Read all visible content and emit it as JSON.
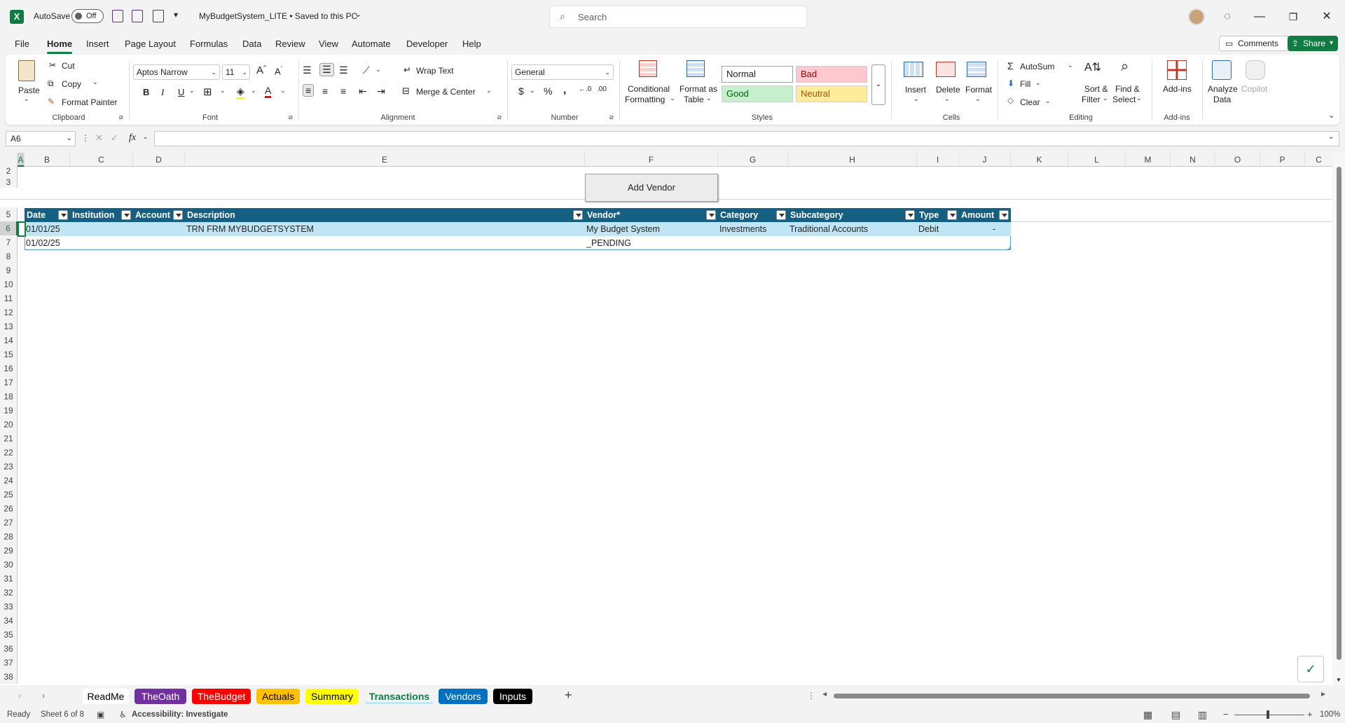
{
  "titlebar": {
    "autosave_label": "AutoSave",
    "autosave_state": "Off",
    "doc_title": "MyBudgetSystem_LITE • Saved to this PC",
    "search_placeholder": "Search"
  },
  "menu": [
    "File",
    "Home",
    "Insert",
    "Page Layout",
    "Formulas",
    "Data",
    "Review",
    "View",
    "Automate",
    "Developer",
    "Help"
  ],
  "menu_active": "Home",
  "comments_label": "Comments",
  "share_label": "Share",
  "ribbon": {
    "clipboard": {
      "paste": "Paste",
      "cut": "Cut",
      "copy": "Copy",
      "format_painter": "Format Painter",
      "label": "Clipboard"
    },
    "font": {
      "name": "Aptos Narrow",
      "size": "11",
      "label": "Font",
      "bold": "B",
      "italic": "I",
      "underline": "U"
    },
    "alignment": {
      "wrap": "Wrap Text",
      "merge": "Merge & Center",
      "label": "Alignment"
    },
    "number": {
      "format": "General",
      "label": "Number"
    },
    "styles": {
      "conditional": "Conditional",
      "conditional2": "Formatting",
      "format_table": "Format as",
      "format_table2": "Table",
      "normal": "Normal",
      "bad": "Bad",
      "good": "Good",
      "neutral": "Neutral",
      "label": "Styles"
    },
    "cells": {
      "insert": "Insert",
      "delete": "Delete",
      "format": "Format",
      "label": "Cells"
    },
    "editing": {
      "autosum": "AutoSum",
      "fill": "Fill",
      "clear": "Clear",
      "sort": "Sort &",
      "sort2": "Filter",
      "find": "Find &",
      "find2": "Select",
      "label": "Editing"
    },
    "addins": {
      "addins": "Add-ins",
      "label": "Add-ins"
    },
    "analyze": {
      "line1": "Analyze",
      "line2": "Data"
    },
    "copilot": "Copilot"
  },
  "formula": {
    "namebox": "A6",
    "fx": "fx",
    "content": ""
  },
  "columns": [
    "A",
    "B",
    "C",
    "D",
    "E",
    "F",
    "G",
    "H",
    "I",
    "J",
    "K",
    "L",
    "M",
    "N",
    "O",
    "P",
    "C"
  ],
  "rows": [
    "2",
    "3",
    "5",
    "6",
    "7",
    "8",
    "9",
    "10",
    "11",
    "12",
    "13",
    "14",
    "15",
    "16",
    "17",
    "18",
    "19",
    "20",
    "21",
    "22",
    "23",
    "24",
    "25",
    "26",
    "27",
    "28",
    "29",
    "30",
    "31",
    "32",
    "33",
    "34",
    "35",
    "36",
    "37",
    "38"
  ],
  "add_vendor_button": "Add Vendor",
  "table": {
    "headers": [
      "Date",
      "Institution",
      "Account",
      "Description",
      "Vendor*",
      "Category",
      "Subcategory",
      "Type",
      "Amount"
    ],
    "rows": [
      [
        "01/01/25",
        "",
        "",
        "TRN FRM MYBUDGETSYSTEM",
        "My Budget System",
        "Investments",
        "Traditional Accounts",
        "Debit",
        "-"
      ],
      [
        "01/02/25",
        "",
        "",
        "",
        "_PENDING",
        "",
        "",
        "",
        ""
      ]
    ]
  },
  "sheet_tabs": [
    {
      "name": "ReadMe",
      "color": "#ffffff"
    },
    {
      "name": "TheOath",
      "color": "#7030a0"
    },
    {
      "name": "TheBudget",
      "color": "#ff0000"
    },
    {
      "name": "Actuals",
      "color": "#ffc000"
    },
    {
      "name": "Summary",
      "color": "#ffff00"
    },
    {
      "name": "Transactions",
      "color": "#c0e6f5"
    },
    {
      "name": "Vendors",
      "color": "#0070c0"
    },
    {
      "name": "Inputs",
      "color": "#000000"
    }
  ],
  "active_tab": "Transactions",
  "status": {
    "ready": "Ready",
    "sheet": "Sheet 6 of 8",
    "accessibility": "Accessibility: Investigate",
    "zoom": "100%"
  }
}
